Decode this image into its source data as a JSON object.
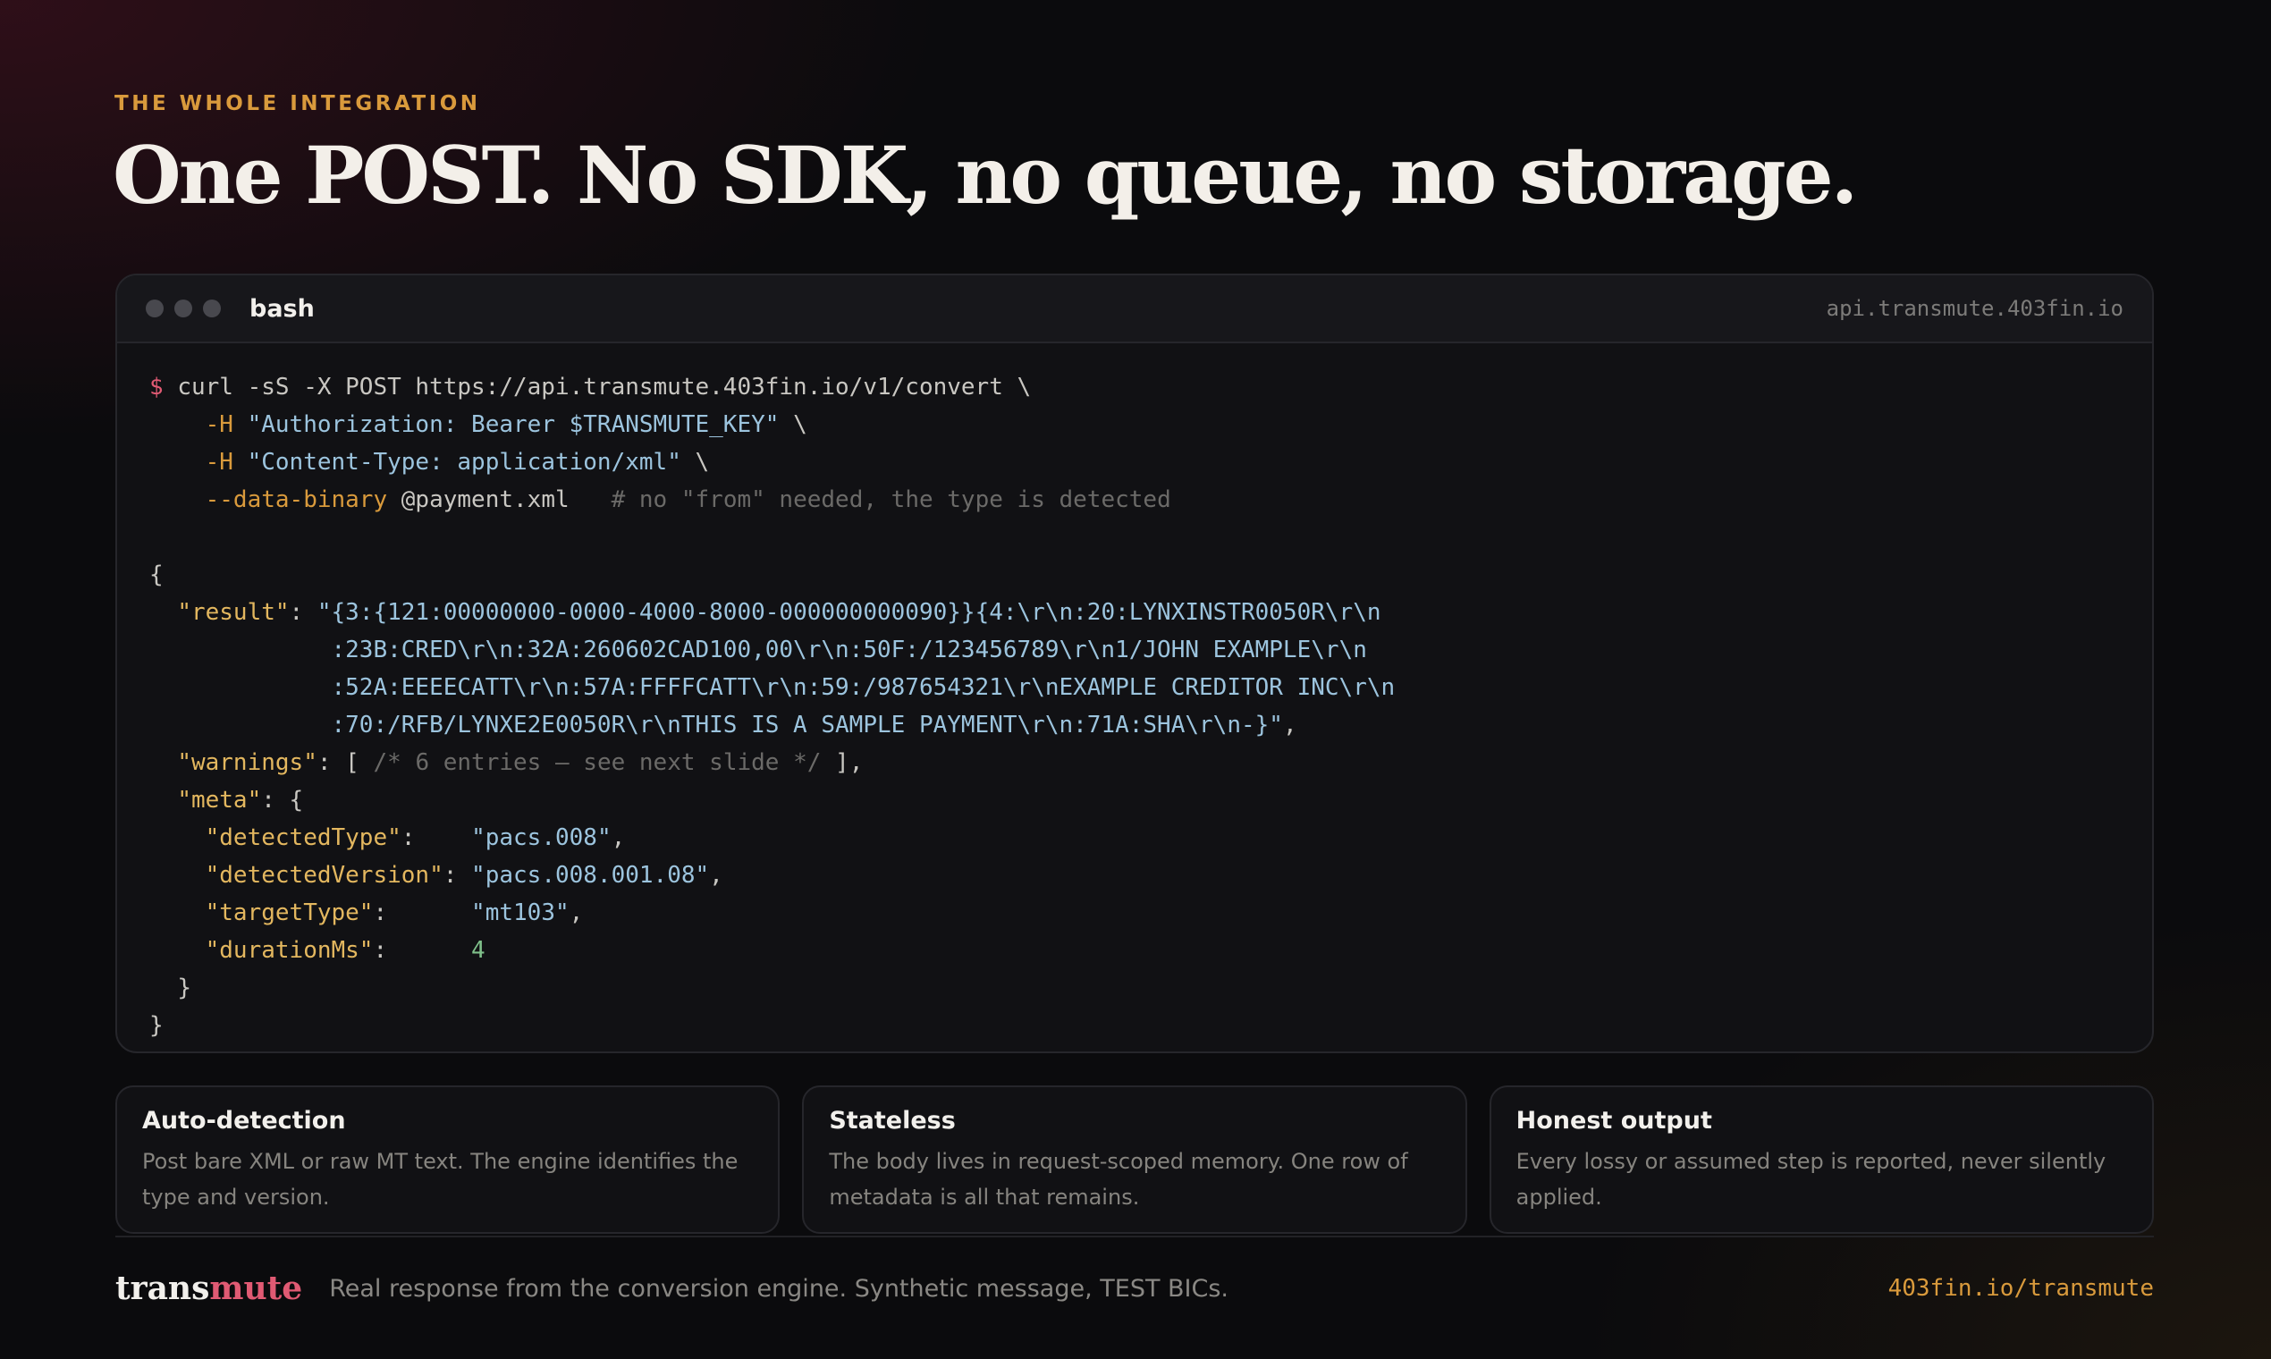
{
  "eyebrow": "THE WHOLE INTEGRATION",
  "headline": "One POST. No SDK, no queue, no storage.",
  "terminal": {
    "language": "bash",
    "host": "api.transmute.403fin.io",
    "command": {
      "prompt": "$",
      "line1": "curl -sS -X POST https://api.transmute.403fin.io/v1/convert \\",
      "h_flag": "-H",
      "auth_header": "\"Authorization: Bearer $TRANSMUTE_KEY\"",
      "content_type_header": "\"Content-Type: application/xml\"",
      "continuation": "\\",
      "data_flag": "--data-binary",
      "data_file": "@payment.xml",
      "comment": "# no \"from\" needed, the type is detected"
    },
    "response": {
      "open_brace": "{",
      "result_key": "\"result\"",
      "result_lines": [
        "\"{3:{121:00000000-0000-4000-8000-000000000090}}{4:\\r\\n:20:LYNXINSTR0050R\\r\\n",
        ":23B:CRED\\r\\n:32A:260602CAD100,00\\r\\n:50F:/123456789\\r\\n1/JOHN EXAMPLE\\r\\n",
        ":52A:EEEECATT\\r\\n:57A:FFFFCATT\\r\\n:59:/987654321\\r\\nEXAMPLE CREDITOR INC\\r\\n",
        ":70:/RFB/LYNXE2E0050R\\r\\nTHIS IS A SAMPLE PAYMENT\\r\\n:71A:SHA\\r\\n-}\""
      ],
      "warnings_key": "\"warnings\"",
      "warnings_comment": "/* 6 entries — see next slide */",
      "meta_key": "\"meta\"",
      "meta": {
        "detectedType_key": "\"detectedType\"",
        "detectedType": "\"pacs.008\"",
        "detectedVersion_key": "\"detectedVersion\"",
        "detectedVersion": "\"pacs.008.001.08\"",
        "targetType_key": "\"targetType\"",
        "targetType": "\"mt103\"",
        "durationMs_key": "\"durationMs\"",
        "durationMs": "4"
      },
      "close_meta": "}",
      "close_brace": "}"
    }
  },
  "cards": [
    {
      "title": "Auto-detection",
      "body": "Post bare XML or raw MT text. The engine identifies the type and version."
    },
    {
      "title": "Stateless",
      "body": "The body lives in request-scoped memory. One row of metadata is all that remains."
    },
    {
      "title": "Honest output",
      "body": "Every lossy or assumed step is reported, never silently applied."
    }
  ],
  "footer": {
    "logo_part1": "trans",
    "logo_part2": "mute",
    "caption": "Real response from the conversion engine. Synthetic message, TEST BICs.",
    "link": "403fin.io/transmute"
  },
  "colors": {
    "accent_amber": "#d99a3c",
    "accent_pink": "#e05a73",
    "string_blue": "#9cc4de",
    "key_gold": "#e3b75f",
    "number_green": "#7fc08a"
  },
  "icons": [
    "window-dot-icon",
    "window-dot-icon",
    "window-dot-icon"
  ]
}
